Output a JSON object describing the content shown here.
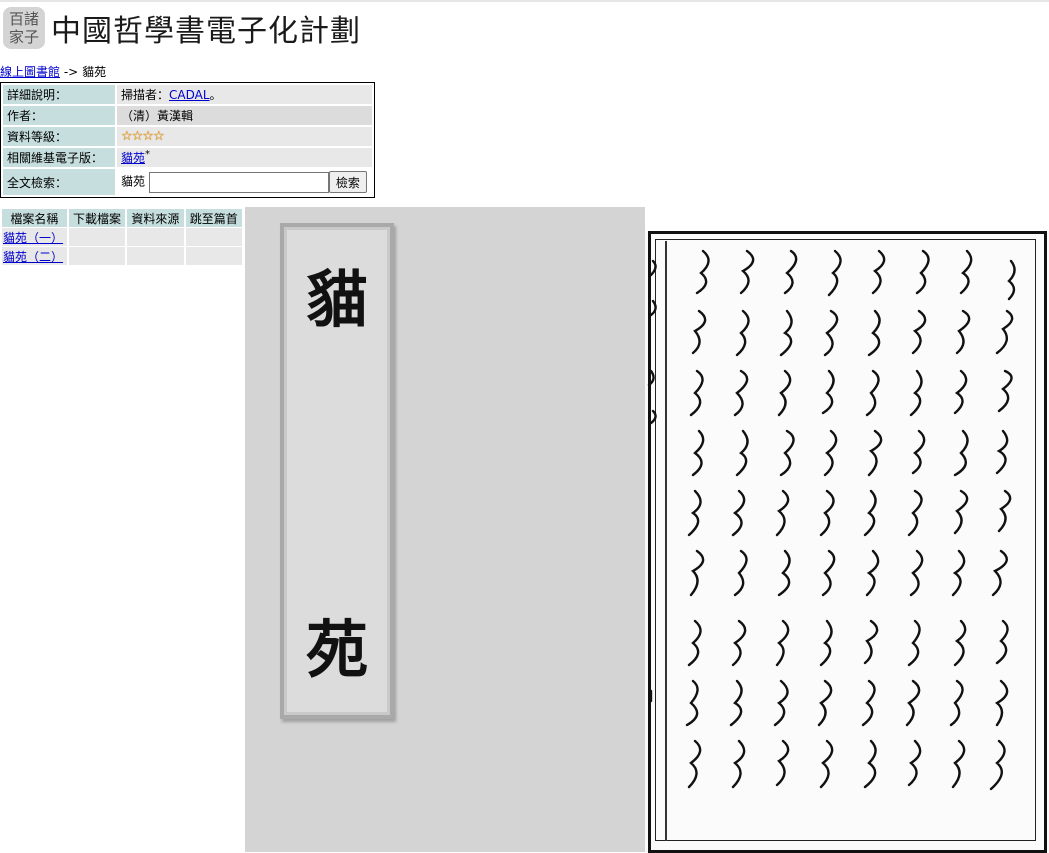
{
  "header": {
    "logo_line1": "百諸",
    "logo_line2": "家子",
    "title": "中國哲學書電子化計劃"
  },
  "breadcrumb": {
    "link": "線上圖書館",
    "separator": "->",
    "current": "貓苑"
  },
  "info": {
    "detail_label": "詳細說明：",
    "detail_prefix": "掃描者：",
    "detail_link": "CADAL",
    "detail_suffix": "。",
    "author_label": "作者：",
    "author_value": "（清）黃漢輯",
    "grade_label": "資料等級：",
    "grade_stars": "☆☆☆☆",
    "grade_value": 4,
    "wiki_label": "相關維基電子版：",
    "wiki_link": "貓苑",
    "wiki_sup": "*",
    "search_label": "全文檢索：",
    "search_prefix": "貓苑",
    "search_value": "",
    "search_button": "檢索"
  },
  "files": {
    "headers": [
      "檔案名稱",
      "下載檔案",
      "資料來源",
      "跳至篇首"
    ],
    "rows": [
      {
        "name": "貓苑（一）"
      },
      {
        "name": "貓苑（二）"
      }
    ]
  },
  "cover": {
    "char1": "貓",
    "char2": "苑"
  }
}
